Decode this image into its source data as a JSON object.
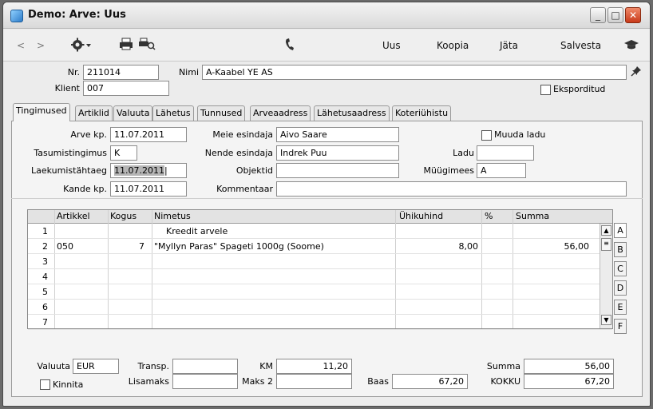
{
  "window": {
    "title": "Demo: Arve: Uus"
  },
  "toolbar": {
    "new_label": "Uus",
    "copy_label": "Koopia",
    "skip_label": "Jäta",
    "save_label": "Salvesta"
  },
  "header": {
    "nr_label": "Nr.",
    "nr_value": "211014",
    "name_label": "Nimi",
    "name_value": "A-Kaabel YE AS",
    "client_label": "Klient",
    "client_value": "007",
    "exported_label": "Eksporditud"
  },
  "tabs": [
    "Tingimused",
    "Artiklid",
    "Valuuta",
    "Lähetus",
    "Tunnused",
    "Arveaadress",
    "Lähetusaadress",
    "Koteriühistu"
  ],
  "terms": {
    "invoice_date_label": "Arve kp.",
    "invoice_date": "11.07.2011",
    "payment_terms_label": "Tasumistingimus",
    "payment_terms": "K",
    "due_date_label": "Laekumistähtaeg",
    "due_date": "11.07.2011",
    "trans_date_label": "Kande kp.",
    "trans_date": "11.07.2011",
    "our_rep_label": "Meie esindaja",
    "our_rep": "Aivo Saare",
    "their_rep_label": "Nende esindaja",
    "their_rep": "Indrek Puu",
    "objects_label": "Objektid",
    "objects": "",
    "comment_label": "Kommentaar",
    "comment": "",
    "change_location_label": "Muuda ladu",
    "location_label": "Ladu",
    "location": "",
    "salesman_label": "Müügimees",
    "salesman": "A"
  },
  "grid": {
    "columns": [
      "Artikkel",
      "Kogus",
      "Nimetus",
      "Ühikuhind",
      "%",
      "Summa"
    ],
    "rows": [
      {
        "n": "1",
        "article": "",
        "qty": "",
        "name": "Kreedit arvele",
        "price": "",
        "pct": "",
        "sum": ""
      },
      {
        "n": "2",
        "article": "050",
        "qty": "7",
        "name": "\"Myllyn Paras\" Spageti 1000g  (Soome)",
        "price": "8,00",
        "pct": "",
        "sum": "56,00"
      },
      {
        "n": "3",
        "article": "",
        "qty": "",
        "name": "",
        "price": "",
        "pct": "",
        "sum": ""
      },
      {
        "n": "4",
        "article": "",
        "qty": "",
        "name": "",
        "price": "",
        "pct": "",
        "sum": ""
      },
      {
        "n": "5",
        "article": "",
        "qty": "",
        "name": "",
        "price": "",
        "pct": "",
        "sum": ""
      },
      {
        "n": "6",
        "article": "",
        "qty": "",
        "name": "",
        "price": "",
        "pct": "",
        "sum": ""
      },
      {
        "n": "7",
        "article": "",
        "qty": "",
        "name": "",
        "price": "",
        "pct": "",
        "sum": ""
      }
    ],
    "side_tabs": [
      "A",
      "B",
      "C",
      "D",
      "E",
      "F"
    ]
  },
  "footer": {
    "currency_label": "Valuuta",
    "currency": "EUR",
    "approve_label": "Kinnita",
    "transp_label": "Transp.",
    "transp": "",
    "extra_label": "Lisamaks",
    "extra": "",
    "vat_label": "KM",
    "vat": "11,20",
    "tax2_label": "Maks 2",
    "tax2": "",
    "base_label": "Baas",
    "base": "67,20",
    "sum_label": "Summa",
    "sum": "56,00",
    "total_label": "KOKKU",
    "total": "67,20"
  }
}
